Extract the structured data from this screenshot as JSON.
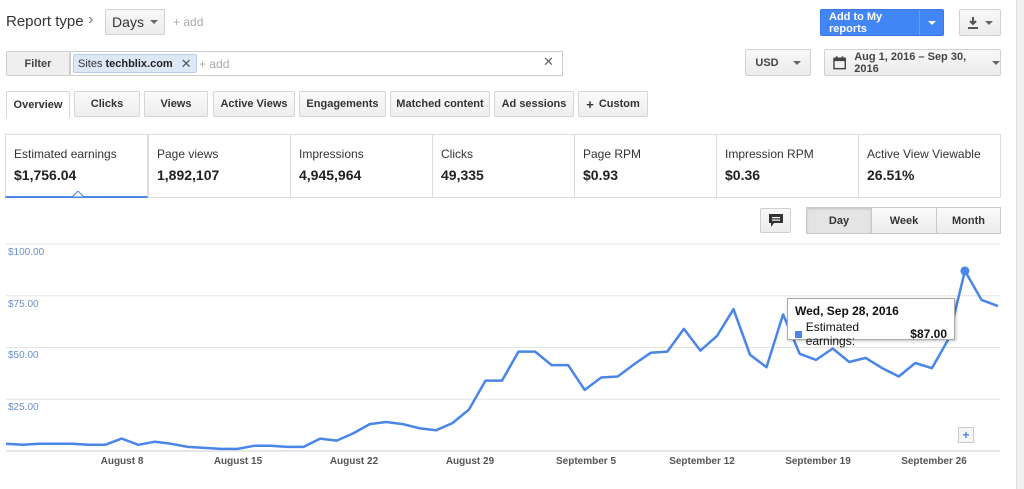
{
  "header": {
    "report_type_label": "Report type",
    "dimension_value": "Days",
    "add_link": "+ add",
    "add_to_reports_label": "Add to My reports"
  },
  "filter_bar": {
    "filter_label": "Filter",
    "chip_key": "Sites",
    "chip_value": "techblix.com",
    "add_placeholder": "+ add",
    "currency": "USD",
    "date_range": "Aug 1, 2016 – Sep 30, 2016"
  },
  "tabs": [
    {
      "label": "Overview"
    },
    {
      "label": "Clicks"
    },
    {
      "label": "Views"
    },
    {
      "label": "Active Views"
    },
    {
      "label": "Engagements"
    },
    {
      "label": "Matched content"
    },
    {
      "label": "Ad sessions"
    },
    {
      "label": "Custom"
    }
  ],
  "metrics": [
    {
      "label": "Estimated earnings",
      "value": "$1,756.04"
    },
    {
      "label": "Page views",
      "value": "1,892,107"
    },
    {
      "label": "Impressions",
      "value": "4,945,964"
    },
    {
      "label": "Clicks",
      "value": "49,335"
    },
    {
      "label": "Page RPM",
      "value": "$0.93"
    },
    {
      "label": "Impression RPM",
      "value": "$0.36"
    },
    {
      "label": "Active View Viewable",
      "value": "26.51%"
    }
  ],
  "granularity": {
    "day": "Day",
    "week": "Week",
    "month": "Month"
  },
  "tooltip": {
    "date": "Wed, Sep 28, 2016",
    "series_label": "Estimated earnings:",
    "series_value": "$87.00"
  },
  "colors": {
    "accent": "#4a86e8",
    "primary_button": "#4285f4"
  },
  "chart_data": {
    "type": "line",
    "ylim": [
      0,
      100
    ],
    "y_ticks": [
      "$25.00",
      "$50.00",
      "$75.00",
      "$100.00"
    ],
    "x_tick_labels": [
      "August 8",
      "August 15",
      "August 22",
      "August 29",
      "September 5",
      "September 12",
      "September 19",
      "September 26"
    ],
    "x": [
      "Aug 1",
      "Aug 2",
      "Aug 3",
      "Aug 4",
      "Aug 5",
      "Aug 6",
      "Aug 7",
      "Aug 8",
      "Aug 9",
      "Aug 10",
      "Aug 11",
      "Aug 12",
      "Aug 13",
      "Aug 14",
      "Aug 15",
      "Aug 16",
      "Aug 17",
      "Aug 18",
      "Aug 19",
      "Aug 20",
      "Aug 21",
      "Aug 22",
      "Aug 23",
      "Aug 24",
      "Aug 25",
      "Aug 26",
      "Aug 27",
      "Aug 28",
      "Aug 29",
      "Aug 30",
      "Aug 31",
      "Sep 1",
      "Sep 2",
      "Sep 3",
      "Sep 4",
      "Sep 5",
      "Sep 6",
      "Sep 7",
      "Sep 8",
      "Sep 9",
      "Sep 10",
      "Sep 11",
      "Sep 12",
      "Sep 13",
      "Sep 14",
      "Sep 15",
      "Sep 16",
      "Sep 17",
      "Sep 18",
      "Sep 19",
      "Sep 20",
      "Sep 21",
      "Sep 22",
      "Sep 23",
      "Sep 24",
      "Sep 25",
      "Sep 26",
      "Sep 27",
      "Sep 28",
      "Sep 29",
      "Sep 30"
    ],
    "values": [
      3.5,
      3,
      3.5,
      3.5,
      3.5,
      3,
      3,
      6,
      3,
      4.5,
      3.5,
      2,
      1.5,
      1,
      1,
      2.5,
      2.5,
      2,
      2,
      6,
      5,
      8.5,
      13,
      14,
      13,
      11,
      10,
      13.5,
      20,
      34,
      34,
      48,
      48,
      41.5,
      41.5,
      29.5,
      35.5,
      36,
      42,
      47.5,
      48,
      59,
      48.5,
      55.5,
      68.5,
      46.5,
      40.5,
      66,
      47,
      44,
      49.5,
      43,
      45,
      40,
      36,
      42.5,
      40,
      54,
      87,
      73,
      70
    ],
    "highlight_date": "Sep 28",
    "highlight_value": 87
  }
}
